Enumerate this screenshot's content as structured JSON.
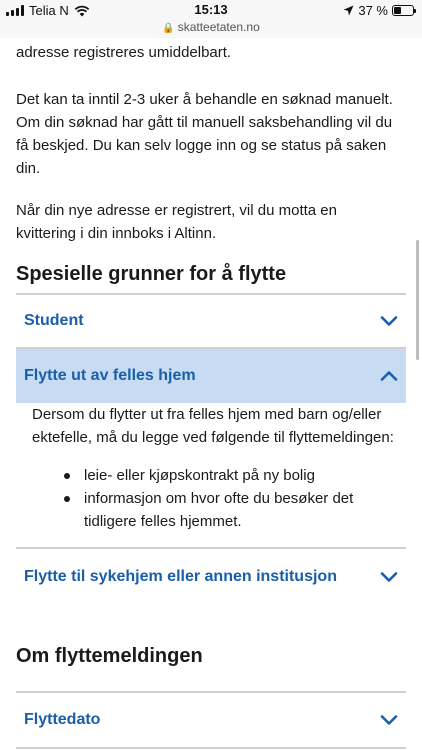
{
  "status_bar": {
    "carrier": "Telia N",
    "time": "15:13",
    "url": "skatteetaten.no",
    "battery_percent": "37 %",
    "battery_level": 0.37
  },
  "intro_paragraphs": [
    "adresse registreres umiddelbart.",
    "Det kan ta inntil 2-3 uker å behandle en søknad manuelt. Om din søknad har gått til manuell saksbehandling vil du få beskjed. Du kan selv logge inn og se status på saken din.",
    "Når din nye adresse er registrert, vil du motta en kvittering i din innboks i Altinn."
  ],
  "section1": {
    "heading": "Spesielle grunner for å flytte",
    "accordions": [
      {
        "label": "Student",
        "expanded": false
      },
      {
        "label": "Flytte ut av felles hjem",
        "expanded": true,
        "body": "Dersom du flytter ut fra felles hjem med barn og/eller ektefelle, må du legge ved følgende til flyttemeldingen:",
        "bullets": [
          "leie- eller kjøpskontrakt på ny bolig",
          "informasjon om hvor ofte du besøker det tidligere felles hjemmet."
        ]
      },
      {
        "label": "Flytte til sykehjem eller annen institusjon",
        "expanded": false
      }
    ]
  },
  "section2": {
    "heading": "Om flyttemeldingen",
    "accordions": [
      {
        "label": "Flyttedato",
        "expanded": false
      }
    ]
  },
  "colors": {
    "link": "#1a5ea8",
    "expanded_bg": "#c7dcf3",
    "divider": "#cfcfcf"
  }
}
